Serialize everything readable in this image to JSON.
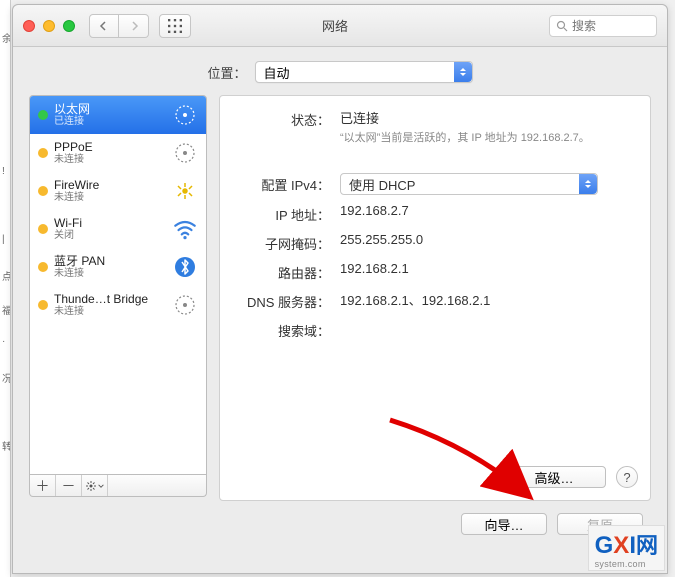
{
  "window": {
    "title": "网络"
  },
  "search": {
    "placeholder": "搜索"
  },
  "location": {
    "label": "位置：",
    "value": "自动"
  },
  "services": [
    {
      "name": "以太网",
      "status": "已连接",
      "dot": "#33c748",
      "selected": true,
      "icon": "ethernet"
    },
    {
      "name": "PPPoE",
      "status": "未连接",
      "dot": "#f7b92e",
      "icon": "ethernet-gray"
    },
    {
      "name": "FireWire",
      "status": "未连接",
      "dot": "#f7b92e",
      "icon": "firewire"
    },
    {
      "name": "Wi-Fi",
      "status": "关闭",
      "dot": "#f7b92e",
      "icon": "wifi"
    },
    {
      "name": "蓝牙 PAN",
      "status": "未连接",
      "dot": "#f7b92e",
      "icon": "bluetooth"
    },
    {
      "name": "Thunde…t Bridge",
      "status": "未连接",
      "dot": "#f7b92e",
      "icon": "ethernet-gray"
    }
  ],
  "detail": {
    "status_label": "状态：",
    "status_value": "已连接",
    "status_sub": "“以太网”当前是活跃的，其 IP 地址为 192.168.2.7。",
    "ipv4_label": "配置 IPv4：",
    "ipv4_value": "使用 DHCP",
    "ip_label": "IP 地址：",
    "ip_value": "192.168.2.7",
    "mask_label": "子网掩码：",
    "mask_value": "255.255.255.0",
    "router_label": "路由器：",
    "router_value": "192.168.2.1",
    "dns_label": "DNS 服务器：",
    "dns_value": "192.168.2.1、192.168.2.1",
    "search_label": "搜索域：",
    "advanced": "高级…",
    "help": "?"
  },
  "footer": {
    "assist": "向导…",
    "revert": "复原"
  },
  "watermark": {
    "text1": "G",
    "text2": "X",
    "text3": "I",
    "cn": "网",
    "sys": "system.com"
  }
}
